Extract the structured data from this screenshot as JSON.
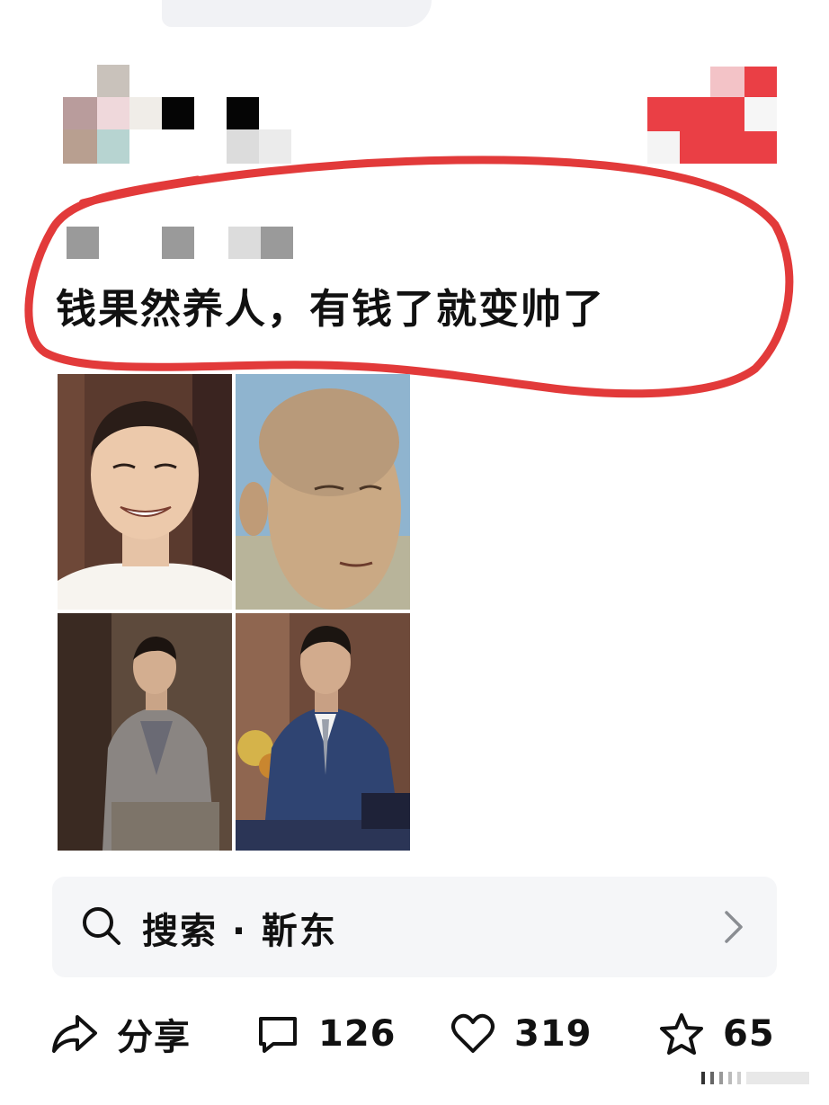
{
  "post": {
    "text": "钱果然养人，有钱了就变帅了"
  },
  "search": {
    "label": "搜索 · 靳东"
  },
  "actions": {
    "share_label": "分享",
    "comment_count": "126",
    "like_count": "319",
    "favorite_count": "65"
  },
  "colors": {
    "annotation_red": "#e23a3a",
    "search_bg": "#f5f6f8",
    "text": "#111111"
  },
  "icons": [
    "search-icon",
    "chevron-right-icon",
    "share-icon",
    "comment-icon",
    "heart-icon",
    "star-icon"
  ]
}
